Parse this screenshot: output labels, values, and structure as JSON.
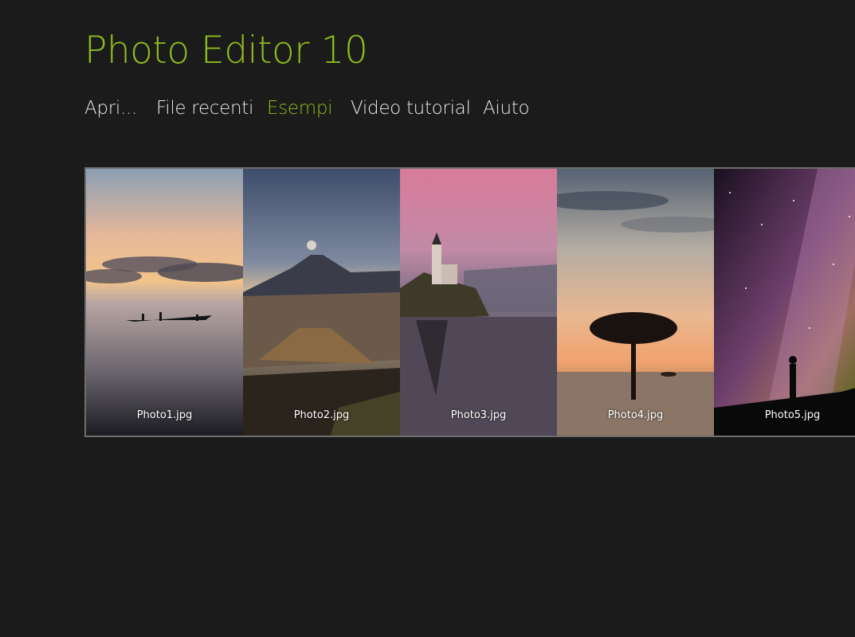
{
  "app": {
    "title": "Photo Editor 10"
  },
  "nav": {
    "items": [
      {
        "label": "Apri..."
      },
      {
        "label": "File recenti"
      },
      {
        "label": "Esempi"
      },
      {
        "label": "Video tutorial"
      },
      {
        "label": "Aiuto"
      }
    ],
    "active_label": "Esempi"
  },
  "gallery": {
    "photos": [
      {
        "name": "Photo1.jpg",
        "scene": "lake sunset with boat"
      },
      {
        "name": "Photo2.jpg",
        "scene": "volcano landscape"
      },
      {
        "name": "Photo3.jpg",
        "scene": "island church on lake"
      },
      {
        "name": "Photo4.jpg",
        "scene": "savanna tree at sunset"
      },
      {
        "name": "Photo5.jpg",
        "scene": "milky way night sky"
      }
    ]
  },
  "colors": {
    "accent": "#8cbd1e",
    "background": "#1b1b1b",
    "text": "#e8e8e8"
  }
}
